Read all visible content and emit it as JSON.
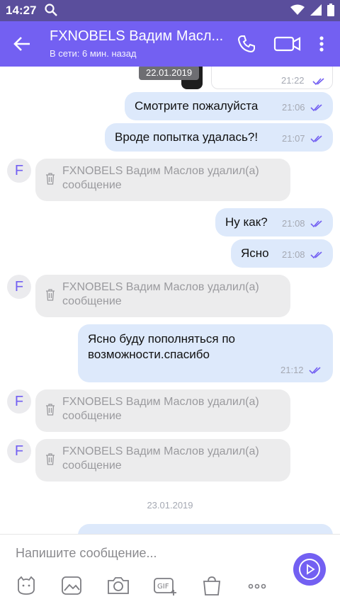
{
  "status_bar": {
    "time": "14:27"
  },
  "header": {
    "title": "FXNOBELS Вадим Масл...",
    "subtitle": "В сети: 6 мин. назад"
  },
  "chat": {
    "top_date": "22.01.2019",
    "top_partial_time": "21:22",
    "outgoing": [
      {
        "text": "Смотрите пожалуйста",
        "time": "21:06"
      },
      {
        "text": "Вроде попытка удалась?!",
        "time": "21:07"
      },
      {
        "text": "Ну как?",
        "time": "21:08"
      },
      {
        "text": "Ясно",
        "time": "21:08"
      },
      {
        "text": "Ясно буду пополняться по возможности.спасибо",
        "time": "21:12"
      }
    ],
    "avatar_letter": "F",
    "deleted_text": "FXNOBELS Вадим Маслов удалил(а) сообщение",
    "bottom_date": "23.01.2019"
  },
  "composer": {
    "placeholder": "Напишите сообщение..."
  },
  "colors": {
    "primary": "#7360f2",
    "status_bar": "#5a4e9c",
    "outgoing_bubble": "#dde9fb",
    "deleted_bubble": "#ececed",
    "ticks": "#7360f2"
  },
  "icons": [
    "search-icon",
    "wifi-icon",
    "signal-icon",
    "battery-icon",
    "back-arrow-icon",
    "phone-icon",
    "video-icon",
    "more-vert-icon",
    "trash-icon",
    "sticker-icon",
    "gallery-icon",
    "camera-icon",
    "gif-icon",
    "shop-icon",
    "more-horiz-icon",
    "send-icon"
  ]
}
